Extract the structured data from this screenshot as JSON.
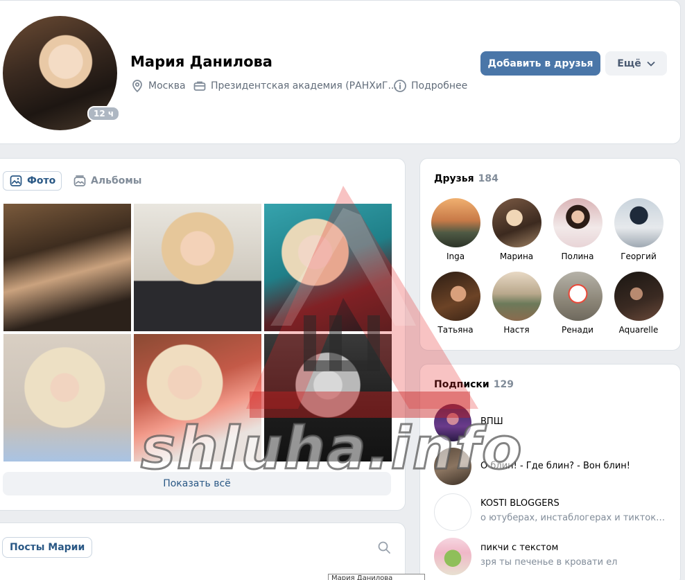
{
  "profile": {
    "name": "Мария Данилова",
    "status_badge": "12 ч",
    "city": "Москва",
    "university": "Президентская академия (РАНХиГ...",
    "details": "Подробнее",
    "add_friend": "Добавить в друзья",
    "more": "Ещё"
  },
  "photos": {
    "tab_photos": "Фото",
    "tab_albums": "Альбомы",
    "show_all": "Показать всё"
  },
  "posts": {
    "tab": "Посты Марии"
  },
  "friends": {
    "title": "Друзья",
    "count": "184",
    "items": [
      {
        "name": "Inga"
      },
      {
        "name": "Марина"
      },
      {
        "name": "Полина"
      },
      {
        "name": "Георгий"
      },
      {
        "name": "Татьяна"
      },
      {
        "name": "Настя"
      },
      {
        "name": "Ренади"
      },
      {
        "name": "Aquarelle"
      }
    ]
  },
  "subscriptions": {
    "title": "Подписки",
    "count": "129",
    "items": [
      {
        "name": "ВПШ",
        "desc": ""
      },
      {
        "name": "О блин! - Где блин? - Вон блин!",
        "desc": ""
      },
      {
        "name": "KOSTI BLOGGERS",
        "desc": "о ютуберах, инстаблогерах и тиктокер..."
      },
      {
        "name": "пикчи с текстом",
        "desc": "зря ты печенье в кровати ел"
      }
    ]
  },
  "watermark": {
    "text": "shluha.info"
  },
  "tooltip": {
    "text": "Мария Данилова"
  },
  "colors": {
    "accent": "#4a76a8",
    "link": "#2a5885",
    "muted": "#818c99"
  }
}
